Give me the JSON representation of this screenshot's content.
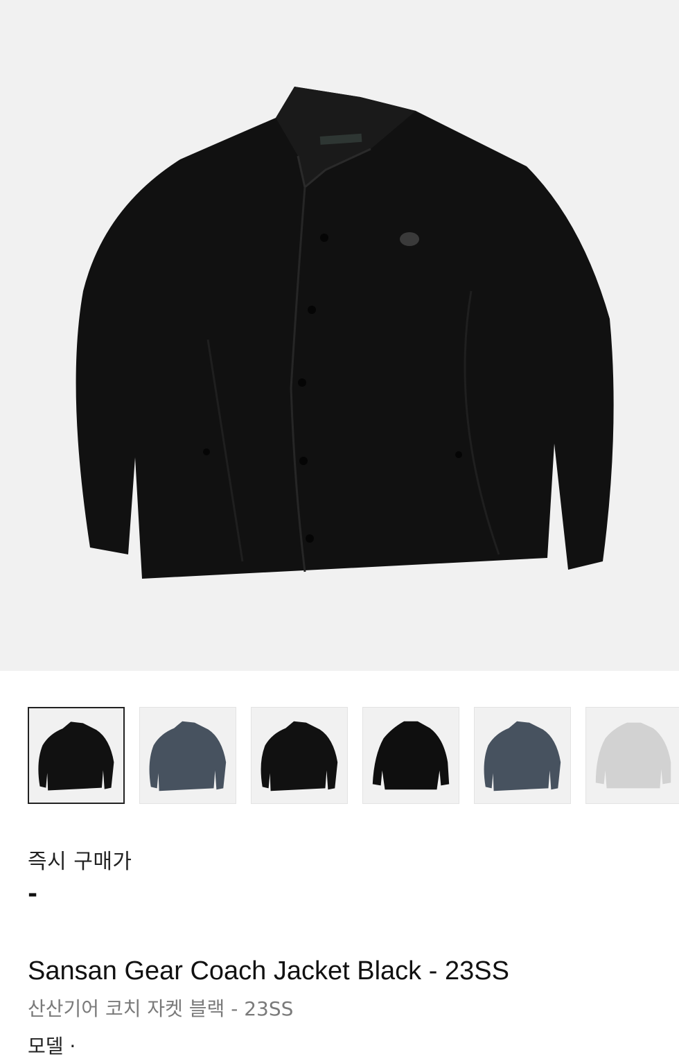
{
  "product": {
    "main_image_alt": "Sansan Gear Coach Jacket Black - 23SS",
    "thumbnails": [
      {
        "color": "#111111",
        "active": true
      },
      {
        "color": "#47525f",
        "active": false
      },
      {
        "color": "#111111",
        "active": false
      },
      {
        "color": "#0f0f0f",
        "active": false
      },
      {
        "color": "#47525f",
        "active": false
      },
      {
        "color": "#d2d2d2",
        "active": false
      }
    ],
    "price_label": "즉시 구매가",
    "price_value": "-",
    "title_en": "Sansan Gear Coach Jacket Black - 23SS",
    "title_ko": "산산기어 코치 자켓 블랙 - 23SS",
    "next_line_partial": "모델 ·"
  },
  "colors": {
    "hero_bg": "#f1f1f1",
    "jacket": "#111111",
    "secondary_text": "#7a7a7a"
  }
}
